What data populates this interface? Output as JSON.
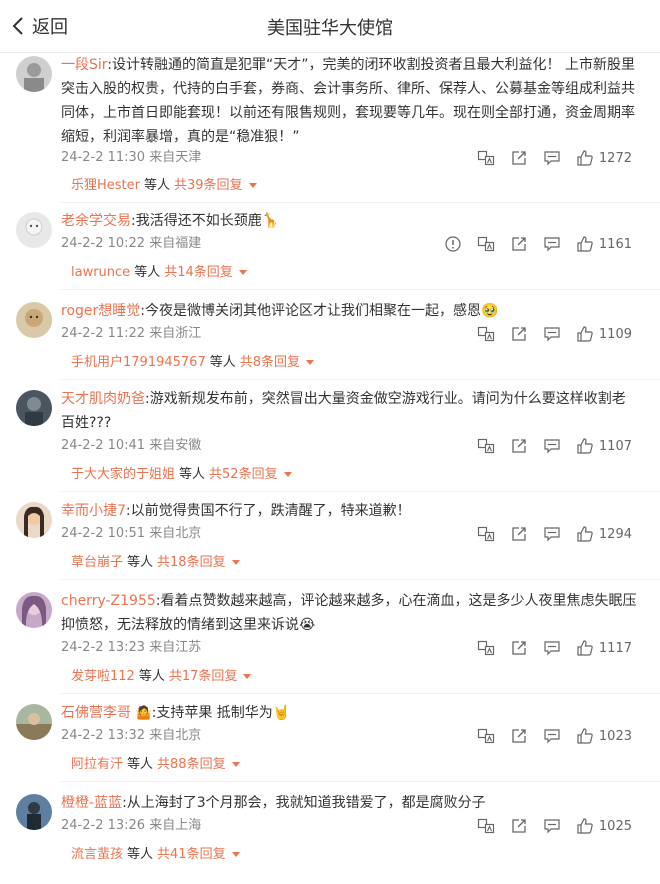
{
  "header": {
    "back_label": "返回",
    "title": "美国驻华大使馆"
  },
  "comments": [
    {
      "username": "一段Sir",
      "content": ":设计转融通的简直是犯罪“天才”，完美的闭环收割投资者且最大利益化！ 上市新股里突击入股的权贵，代持的白手套，券商、会计事务所、律所、保荐人、公募基金等组成利益共同体，上市首日即能套现！以前还有限售规则，套现要等几年。现在则全部打通，资金周期率缩短，利润率暴增，真的是“稳准狠！”",
      "time": "24-2-2 11:30",
      "location": "来自天津",
      "likes": "1272",
      "reply_user": "乐狸Hester",
      "reply_mid": "等人",
      "reply_total": "共39条回复"
    },
    {
      "username": "老余学交易",
      "content": ":我活得还不如长颈鹿🦒",
      "time": "24-2-2 10:22",
      "location": "来自福建",
      "likes": "1161",
      "reply_user": "lawrunce",
      "reply_mid": "等人",
      "reply_total": "共14条回复"
    },
    {
      "username": "roger想睡觉",
      "content": ":今夜是微博关闭其他评论区才让我们相聚在一起，感恩🥹",
      "time": "24-2-2 11:22",
      "location": "来自浙江",
      "likes": "1109",
      "reply_user": "手机用户1791945767",
      "reply_mid": "等人",
      "reply_total": "共8条回复"
    },
    {
      "username": "天才肌肉奶爸",
      "content": ":游戏新规发布前，突然冒出大量资金做空游戏行业。请问为什么要这样收割老百姓???",
      "time": "24-2-2 10:41",
      "location": "来自安徽",
      "likes": "1107",
      "reply_user": "于大大家的于姐姐",
      "reply_mid": "等人",
      "reply_total": "共52条回复"
    },
    {
      "username": "幸而小捷7",
      "content": ":以前觉得贵国不行了，跌清醒了，特来道歉！",
      "time": "24-2-2 10:51",
      "location": "来自北京",
      "likes": "1294",
      "reply_user": "草台崩子",
      "reply_mid": "等人",
      "reply_total": "共18条回复"
    },
    {
      "username": "cherry-Z1955",
      "content": ":看着点赞数越来越高，评论越来越多，心在滴血，这是多少人夜里焦虑失眠压抑愤怒，无法释放的情绪到这里来诉说😭",
      "time": "24-2-2 13:23",
      "location": "来自江苏",
      "likes": "1117",
      "reply_user": "发芽啦112",
      "reply_mid": "等人",
      "reply_total": "共17条回复"
    },
    {
      "username": "石佛营李哥",
      "badge": "🤷",
      "content": ":支持苹果 抵制华为🤘",
      "time": "24-2-2 13:32",
      "location": "来自北京",
      "likes": "1023",
      "reply_user": "阿拉有汗",
      "reply_mid": "等人",
      "reply_total": "共88条回复"
    },
    {
      "username": "橙橙-蓝蓝",
      "content": ":从上海封了3个月那会，我就知道我错爱了，都是腐败分子",
      "time": "24-2-2 13:26",
      "location": "来自上海",
      "likes": "1025",
      "reply_user": "流言蜚孩",
      "reply_mid": "等人",
      "reply_total": "共41条回复"
    }
  ],
  "colors": {
    "username": "#eb7350",
    "meta": "#888888",
    "icon": "#666666"
  },
  "icons": [
    "translate-icon",
    "share-icon",
    "comment-icon",
    "like-icon",
    "report-icon",
    "dropdown-triangle-icon"
  ]
}
